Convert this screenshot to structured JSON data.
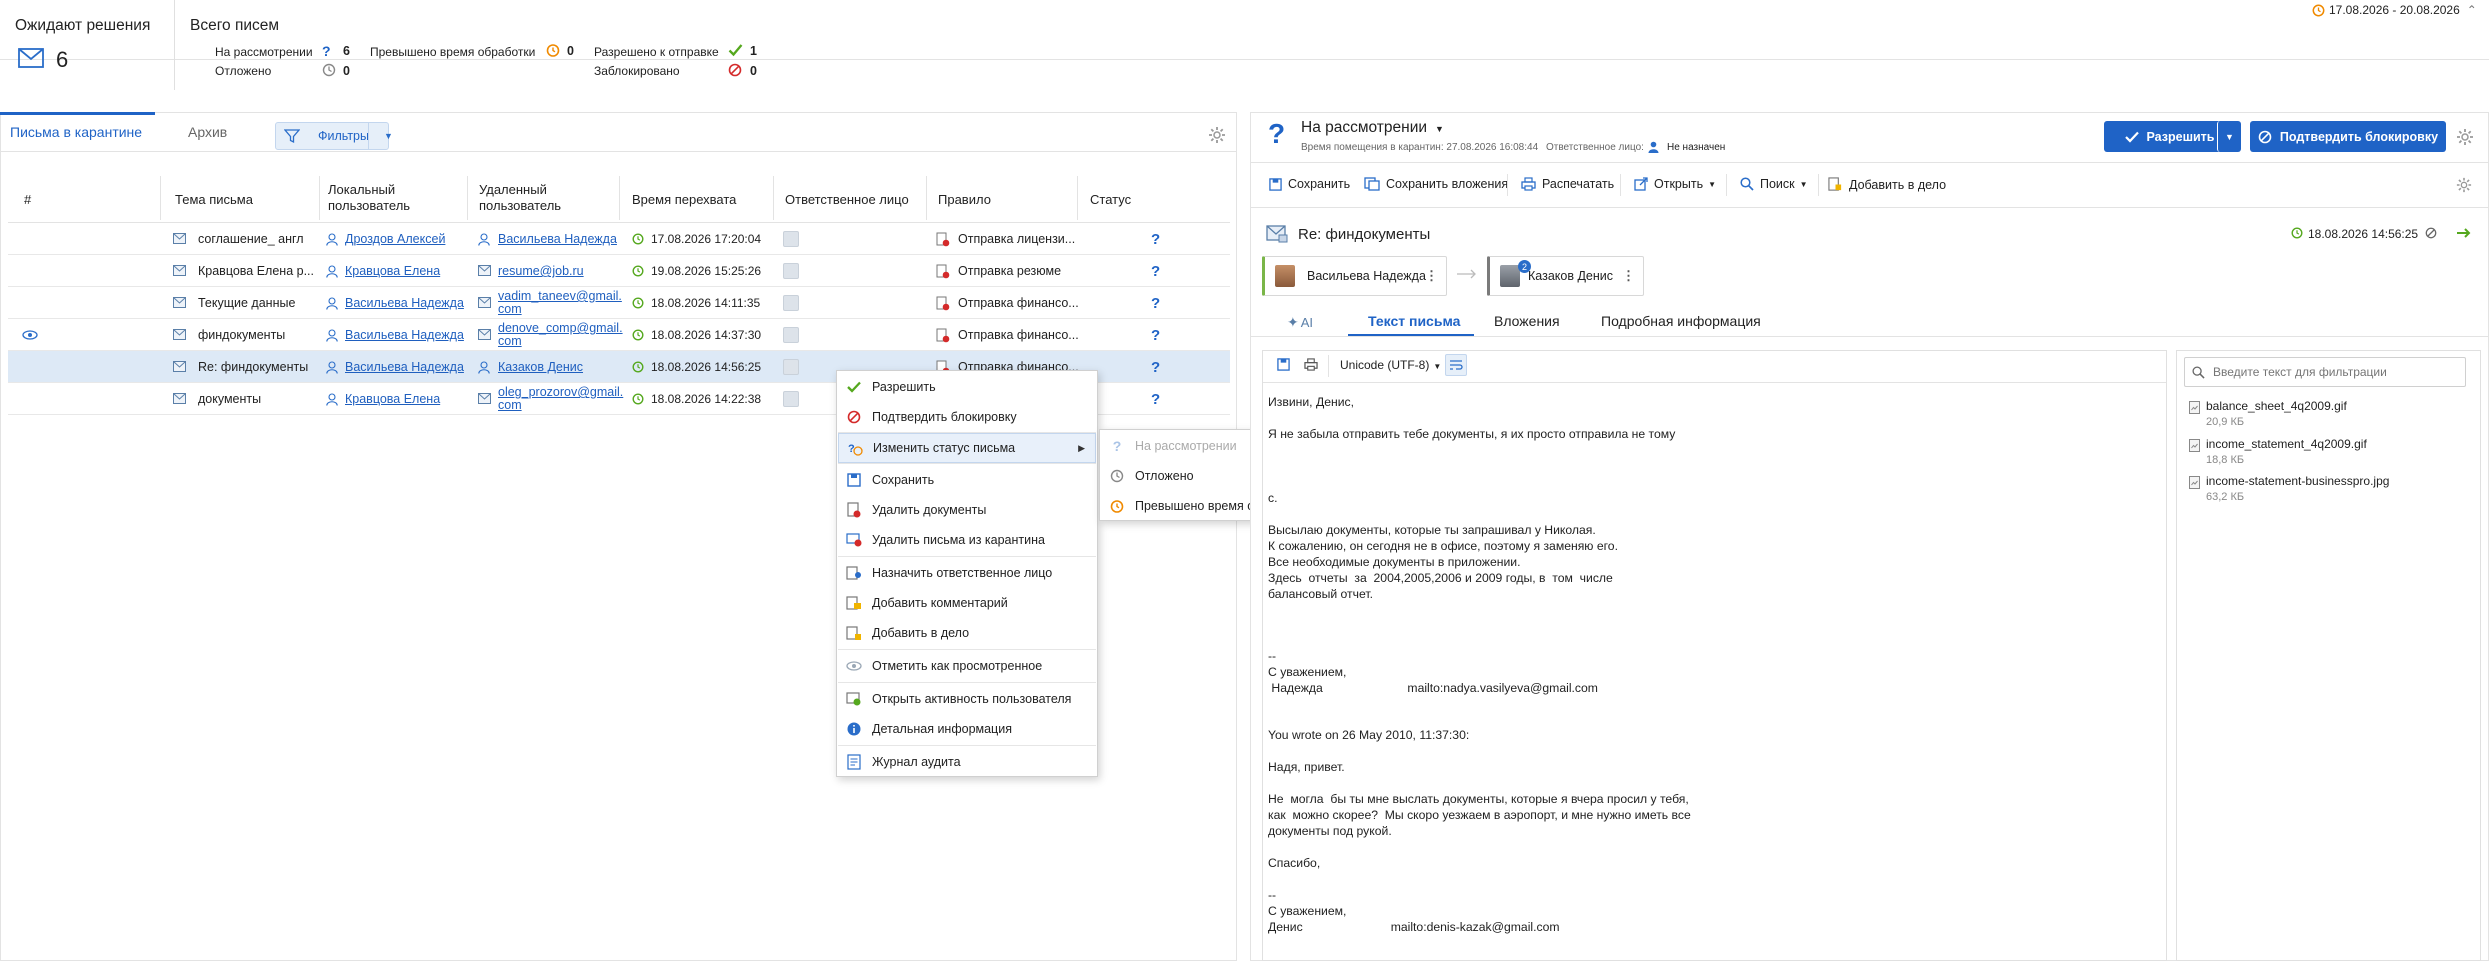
{
  "date_range": "17.08.2026 - 20.08.2026",
  "summary": {
    "pending_title": "Ожидают решения",
    "pending_count": "6",
    "total_title": "Всего писем",
    "stats": {
      "review_label": "На рассмотрении",
      "review_count": "6",
      "postponed_label": "Отложено",
      "postponed_count": "0",
      "overtime_label": "Превышено время обработки",
      "overtime_count": "0",
      "allowed_label": "Разрешено к отправке",
      "allowed_count": "1",
      "blocked_label": "Заблокировано",
      "blocked_count": "0"
    }
  },
  "left": {
    "tabs": [
      "Письма в карантине",
      "Архив"
    ],
    "filters_label": "Фильтры",
    "columns": [
      "#",
      "Тема письма",
      "Локальный пользователь",
      "Удаленный пользователь",
      "Время перехвата",
      "Ответственное лицо",
      "Правило",
      "Статус"
    ],
    "rows": [
      {
        "subject": "соглашение_ англ",
        "local": "Дроздов Алексей",
        "remote": "Васильева Надежда",
        "time": "17.08.2026 17:20:04",
        "rule": "Отправка лицензи...",
        "status": "?"
      },
      {
        "subject": "Кравцова Елена р...",
        "local": "Кравцова Елена",
        "remote": "resume@job.ru",
        "time": "19.08.2026 15:25:26",
        "rule": "Отправка резюме",
        "status": "?"
      },
      {
        "subject": "Текущие данные",
        "local": "Васильева Надежда",
        "remote": "vadim_taneev@gmail.com",
        "time": "18.08.2026 14:11:35",
        "rule": "Отправка финансо...",
        "status": "?"
      },
      {
        "subject": "финдокументы",
        "local": "Васильева Надежда",
        "remote": "denove_comp@gmail.com",
        "time": "18.08.2026 14:37:30",
        "rule": "Отправка финансо...",
        "status": "?"
      },
      {
        "subject": "Re: финдокументы",
        "local": "Васильева Надежда",
        "remote": "Казаков Денис",
        "time": "18.08.2026 14:56:25",
        "rule": "Отправка финансо...",
        "status": "?"
      },
      {
        "subject": "документы",
        "local": "Кравцова Елена",
        "remote": "oleg_prozorov@gmail.com",
        "time": "18.08.2026 14:22:38",
        "rule": "",
        "status": "?"
      }
    ]
  },
  "context_menu": {
    "items": [
      "Разрешить",
      "Подтвердить блокировку",
      "Изменить статус письма",
      "Сохранить",
      "Удалить документы",
      "Удалить письма из карантина",
      "Назначить ответственное лицо",
      "Добавить комментарий",
      "Добавить в дело",
      "Отметить как просмотренное",
      "Открыть активность пользователя",
      "Детальная информация",
      "Журнал аудита"
    ],
    "submenu": [
      "На рассмотрении",
      "Отложено",
      "Превышено время обработки"
    ]
  },
  "right": {
    "status_title": "На рассмотрении",
    "placed_label": "Время помещения в карантин: 27.08.2026 16:08:44",
    "responsible_label": "Ответственное лицо:",
    "responsible_value": "Не назначен",
    "allow_button": "Разрешить",
    "block_button": "Подтвердить блокировку",
    "toolbar": [
      "Сохранить",
      "Сохранить вложения",
      "Распечатать",
      "Открыть",
      "Поиск",
      "Добавить в дело"
    ],
    "subject": "Re: финдокументы",
    "received": "18.08.2026 14:56:25",
    "from": "Васильева Надежда",
    "to": "Казаков Денис",
    "to_badge": "2",
    "tabs": [
      "AI",
      "Текст письма",
      "Вложения",
      "Подробная информация"
    ],
    "encoding": "Unicode (UTF-8)",
    "filter_placeholder": "Введите текст для фильтрации",
    "body_lines": [
      "Извини, Денис,",
      "Я не забыла отправить тебе документы, я их просто отправила не тому",
      "с.",
      "Высылаю документы, которые ты запрашивал у Николая.",
      "К сожалению, он сегодня не в офисе, поэтому я заменяю его.",
      "Все необходимые документы в приложении.",
      "Здесь  отчеты  за  2004,2005,2006 и 2009 годы, в  том  числе",
      "балансовый отчет.",
      "--",
      "С уважением,",
      " Надежда                         mailto:nadya.vasilyeva@gmail.com",
      "You wrote on 26 May 2010, 11:37:30:",
      "Надя, привет.",
      "Не  могла  бы ты мне выслать документы, которые я вчера просил у тебя,",
      "как  можно скорее?  Мы скоро уезжаем в аэропорт, и мне нужно иметь все",
      "документы под рукой.",
      "Спасибо,",
      "--",
      "С уважением,",
      "Денис                          mailto:denis-kazak@gmail.com"
    ],
    "attachments": [
      {
        "name": "balance_sheet_4q2009.gif",
        "size": "20,9 КБ"
      },
      {
        "name": "income_statement_4q2009.gif",
        "size": "18,8 КБ"
      },
      {
        "name": "income-statement-businesspro.jpg",
        "size": "63,2 КБ"
      }
    ]
  }
}
